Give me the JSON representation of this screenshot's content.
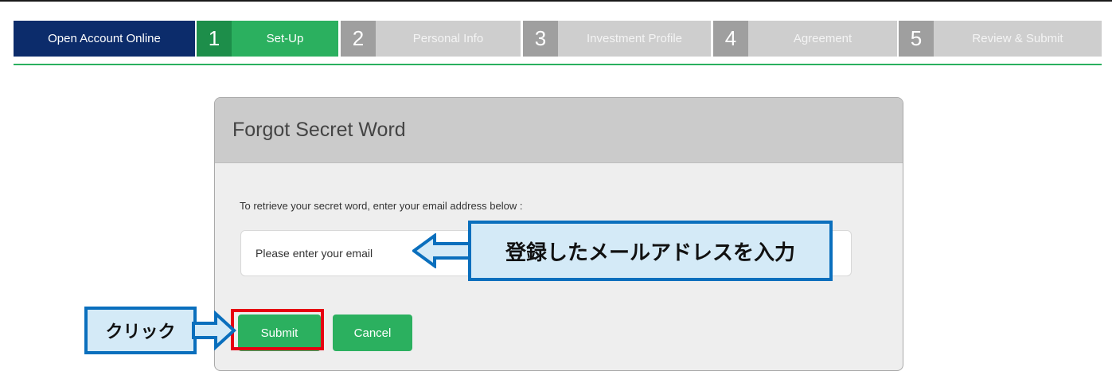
{
  "steps": {
    "open_account": "Open Account Online",
    "items": [
      {
        "num": "1",
        "label": "Set-Up"
      },
      {
        "num": "2",
        "label": "Personal Info"
      },
      {
        "num": "3",
        "label": "Investment Profile"
      },
      {
        "num": "4",
        "label": "Agreement"
      },
      {
        "num": "5",
        "label": "Review & Submit"
      }
    ],
    "active_index": 0
  },
  "dialog": {
    "title": "Forgot Secret Word",
    "instruction": "To retrieve your secret word, enter your email address below :",
    "email_placeholder": "Please enter your email",
    "submit_label": "Submit",
    "cancel_label": "Cancel"
  },
  "annotations": {
    "email_callout": "登録したメールアドレスを入力",
    "click_callout": "クリック"
  },
  "colors": {
    "navy": "#0c2c6b",
    "green": "#2bb05f",
    "dark_green": "#1d8e4a",
    "highlight_red": "#e60012",
    "callout_blue": "#0a6fbd"
  },
  "icons": {
    "email_arrow": "left-arrow-icon",
    "click_arrow": "right-arrow-icon"
  }
}
